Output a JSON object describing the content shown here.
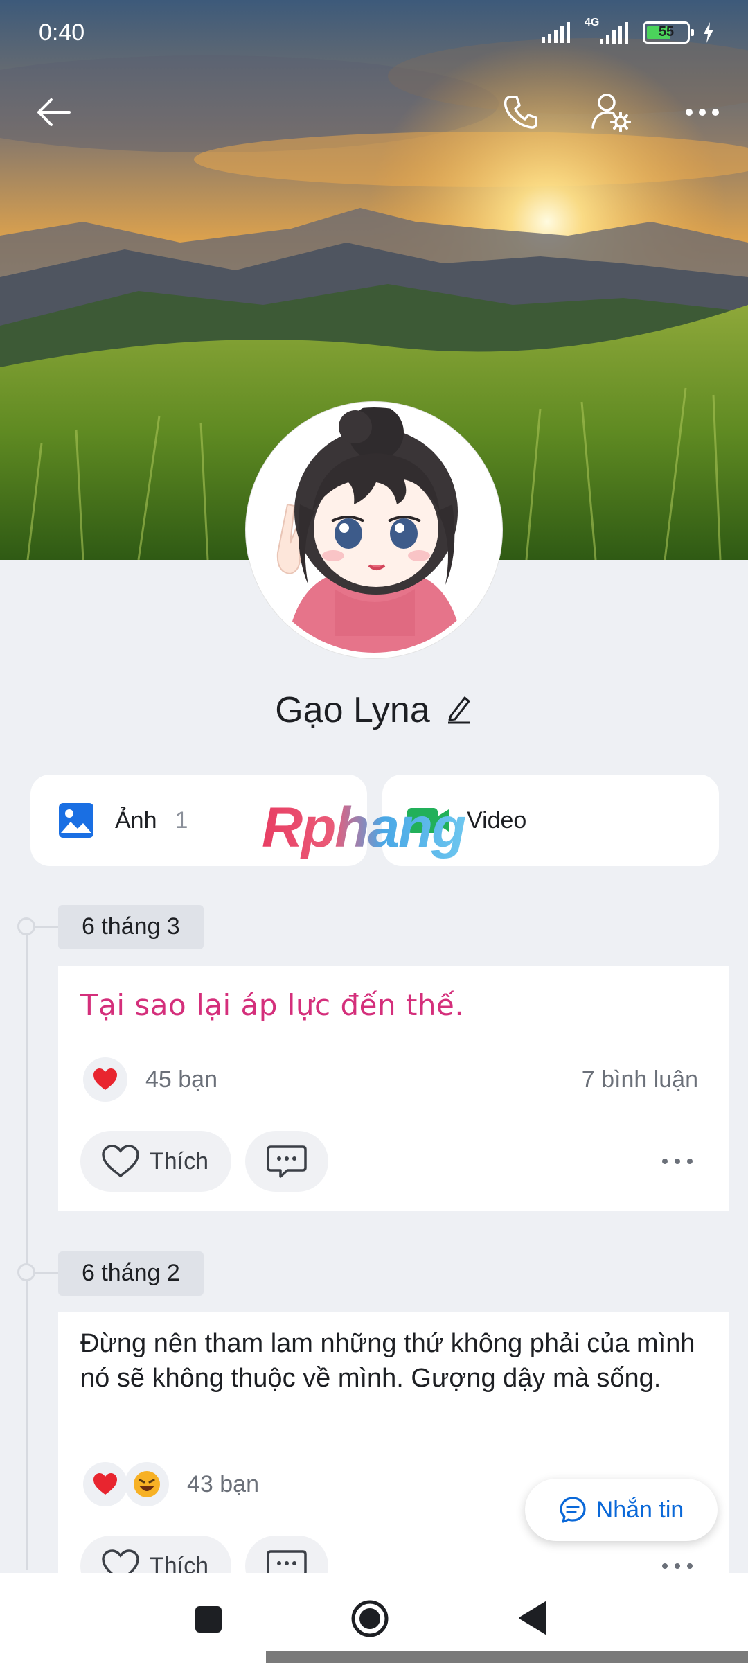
{
  "status_bar": {
    "time": "0:40",
    "network": "4G",
    "battery": "55"
  },
  "profile": {
    "name": "Gạo Lyna"
  },
  "media": {
    "photos": {
      "label": "Ảnh",
      "count": "1"
    },
    "videos": {
      "label": "Video"
    }
  },
  "watermark": "Rphang",
  "posts": [
    {
      "date": "6 tháng 3",
      "text": "Tại sao lại áp lực đến thế.",
      "reactions": "45 bạn",
      "comments": "7 bình luận",
      "like_label": "Thích"
    },
    {
      "date": "6 tháng 2",
      "text": "Đừng nên tham lam những thứ không phải của mình nó sẽ không thuộc về mình. Gượng dậy mà sống.",
      "reactions": "43 bạn",
      "like_label": "Thích"
    }
  ],
  "message_button": {
    "label": "Nhắn tin"
  },
  "icons": [
    "back-arrow-icon",
    "phone-icon",
    "user-settings-icon",
    "more-icon",
    "edit-icon",
    "image-icon",
    "video-icon",
    "heart-icon",
    "comment-icon",
    "haha-icon",
    "chat-icon",
    "square-icon",
    "circle-icon",
    "triangle-back-icon"
  ]
}
